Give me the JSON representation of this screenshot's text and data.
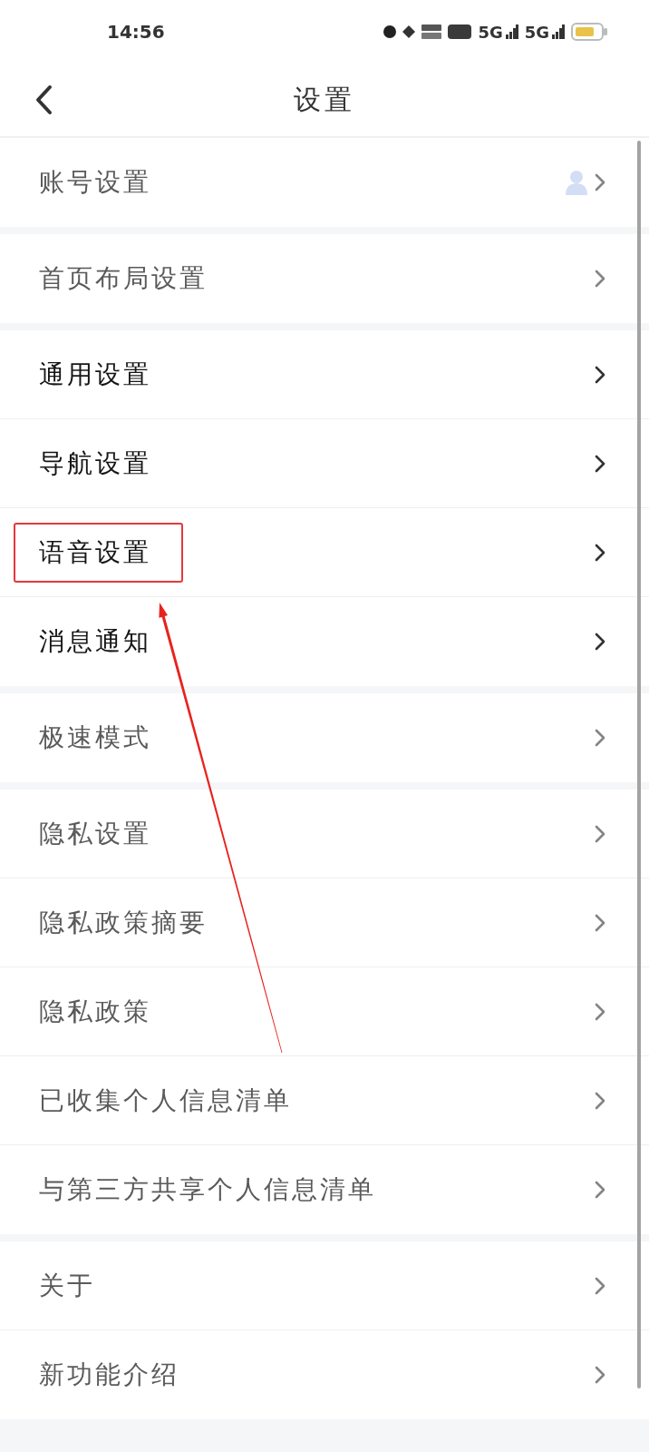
{
  "status_bar": {
    "time": "14:56",
    "signals": [
      {
        "label": "5G"
      },
      {
        "label": "5G"
      }
    ]
  },
  "header": {
    "title": "设置"
  },
  "sections": [
    {
      "items": [
        {
          "label": "账号设置",
          "kind": "avatar",
          "blurred": true,
          "highlighted": false
        }
      ]
    },
    {
      "items": [
        {
          "label": "首页布局设置",
          "kind": "plain",
          "blurred": true,
          "highlighted": false
        }
      ]
    },
    {
      "items": [
        {
          "label": "通用设置",
          "kind": "plain",
          "blurred": false,
          "highlighted": false
        },
        {
          "label": "导航设置",
          "kind": "plain",
          "blurred": false,
          "highlighted": false
        },
        {
          "label": "语音设置",
          "kind": "plain",
          "blurred": false,
          "highlighted": true
        },
        {
          "label": "消息通知",
          "kind": "plain",
          "blurred": false,
          "highlighted": false
        }
      ]
    },
    {
      "items": [
        {
          "label": "极速模式",
          "kind": "plain",
          "blurred": true,
          "highlighted": false
        }
      ]
    },
    {
      "items": [
        {
          "label": "隐私设置",
          "kind": "plain",
          "blurred": true,
          "highlighted": false
        },
        {
          "label": "隐私政策摘要",
          "kind": "plain",
          "blurred": true,
          "highlighted": false
        },
        {
          "label": "隐私政策",
          "kind": "plain",
          "blurred": true,
          "highlighted": false
        },
        {
          "label": "已收集个人信息清单",
          "kind": "plain",
          "blurred": true,
          "highlighted": false
        },
        {
          "label": "与第三方共享个人信息清单",
          "kind": "plain",
          "blurred": true,
          "highlighted": false
        }
      ]
    },
    {
      "items": [
        {
          "label": "关于",
          "kind": "plain",
          "blurred": true,
          "highlighted": false
        },
        {
          "label": "新功能介绍",
          "kind": "plain",
          "blurred": true,
          "highlighted": false
        }
      ]
    }
  ]
}
